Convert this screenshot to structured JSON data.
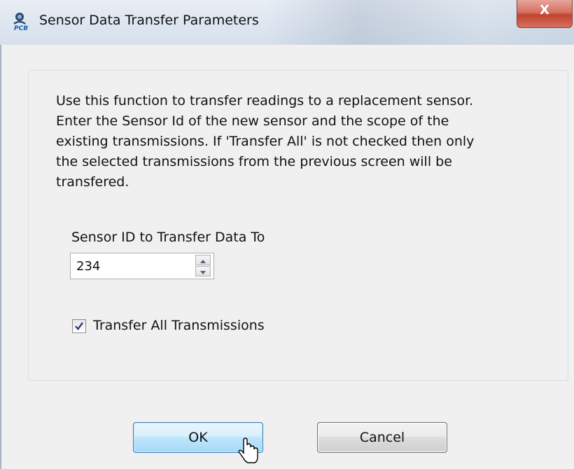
{
  "window": {
    "title": "Sensor Data Transfer Parameters",
    "close_label": "X",
    "icon": "app-sensor-icon"
  },
  "description": "Use this function to transfer readings to a replacement sensor.\nEnter the Sensor Id of the new sensor and the scope of the\nexisting transmissions. If 'Transfer All' is not checked then only\nthe selected transmissions from the previous screen will be\ntransfered.",
  "sensor_id": {
    "label": "Sensor ID to Transfer Data To",
    "value": "234"
  },
  "transfer_all": {
    "label": "Transfer All Transmissions",
    "checked": true
  },
  "buttons": {
    "ok": "OK",
    "cancel": "Cancel"
  },
  "colors": {
    "ok_border": "#3c7fb1",
    "close_red": "#c2432f"
  }
}
